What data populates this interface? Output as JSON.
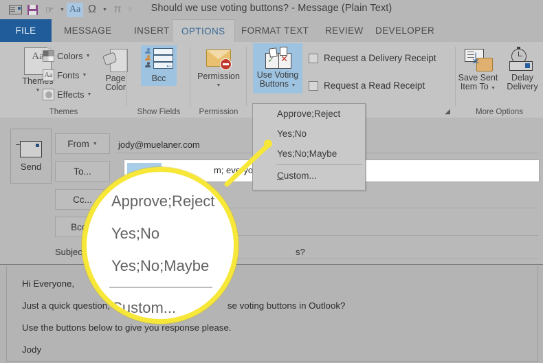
{
  "window": {
    "title": "Should we use voting buttons? - Message (Plain Text)",
    "accent_blue": "#1f5c99",
    "ribbon_bg": "#c4c4c4",
    "highlight_yellow": "#f7e738"
  },
  "quick_access": {
    "items": [
      {
        "name": "new-message-icon",
        "label": "Message"
      },
      {
        "name": "save-icon",
        "label": "Save"
      },
      {
        "name": "touch-mode-icon",
        "label": "Touch/Mouse Mode"
      },
      {
        "name": "text-format-icon",
        "label": "Aa"
      },
      {
        "name": "symbol-icon",
        "label": "Ω"
      },
      {
        "name": "equation-icon",
        "label": "π"
      },
      {
        "name": "customize-qat-icon",
        "label": "Customize Quick Access Toolbar"
      }
    ]
  },
  "tabs": [
    {
      "label": "FILE",
      "active": false,
      "file": true
    },
    {
      "label": "MESSAGE",
      "active": false
    },
    {
      "label": "INSERT",
      "active": false
    },
    {
      "label": "OPTIONS",
      "active": true
    },
    {
      "label": "FORMAT TEXT",
      "active": false
    },
    {
      "label": "REVIEW",
      "active": false
    },
    {
      "label": "DEVELOPER",
      "active": false
    }
  ],
  "ribbon": {
    "groups": [
      {
        "label": "Themes"
      },
      {
        "label": "Show Fields"
      },
      {
        "label": "Permission"
      },
      {
        "label": "More Options"
      }
    ],
    "themes": {
      "gallery_label": "Themes",
      "colors_label": "Colors",
      "fonts_label": "Fonts",
      "effects_label": "Effects",
      "page_color_label_1": "Page",
      "page_color_label_2": "Color"
    },
    "show_fields": {
      "bcc_label": "Bcc"
    },
    "permission": {
      "button_label": "Permission"
    },
    "tracking": {
      "use_voting_label_1": "Use Voting",
      "use_voting_label_2": "Buttons",
      "delivery_receipt_label": "Request a Delivery Receipt",
      "read_receipt_label": "Request a Read Receipt",
      "delivery_receipt_checked": false,
      "read_receipt_checked": false
    },
    "more_options": {
      "save_sent_label_1": "Save Sent",
      "save_sent_label_2": "Item To",
      "delay_label_1": "Delay",
      "delay_label_2": "Delivery"
    }
  },
  "voting_menu": {
    "items": [
      {
        "label": "Approve;Reject"
      },
      {
        "label": "Yes;No"
      },
      {
        "label": "Yes;No;Maybe"
      }
    ],
    "custom": {
      "accel": "C",
      "rest": "ustom..."
    }
  },
  "callout": {
    "items": [
      {
        "label": "Approve;Reject"
      },
      {
        "label": "Yes;No"
      },
      {
        "label": "Yes;No;Maybe"
      }
    ],
    "custom": {
      "accel": "C",
      "rest": "ustom..."
    }
  },
  "compose": {
    "send_label": "Send",
    "from_label": "From",
    "to_label": "To...",
    "cc_label": "Cc...",
    "bcc_label": "Bcc...",
    "subject_label": "Subject",
    "from_value": "jody@muelaner.com",
    "to_value_fragment": "m; everyone@",
    "subject_value_fragment": "s?"
  },
  "body": {
    "lines": [
      "Hi Everyone,",
      "Just a quick question, do you",
      "se voting buttons in Outlook?",
      "Use the buttons below to give you response please.",
      "Jody"
    ]
  }
}
